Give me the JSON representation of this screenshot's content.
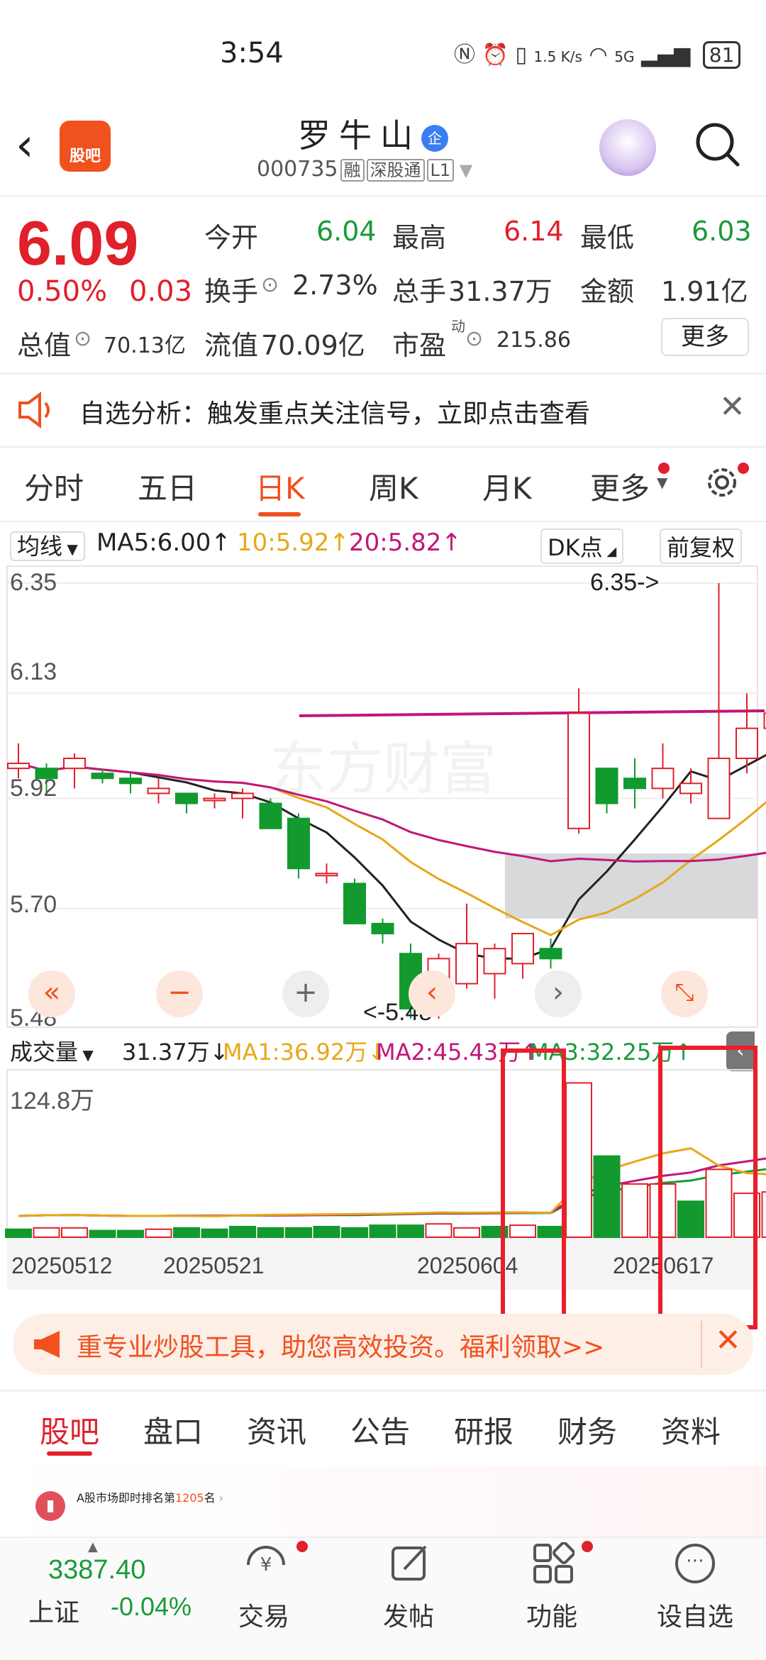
{
  "status": {
    "time": "3:54",
    "net": "1.5 K/s",
    "signal": "5G",
    "battery": "81"
  },
  "header": {
    "back": "‹",
    "logo": "股吧",
    "title": "罗牛山",
    "badge": "企",
    "code": "000735",
    "tags": [
      "融",
      "深股通",
      "L1"
    ]
  },
  "quote": {
    "price": "6.09",
    "pct": "0.50%",
    "change": "0.03",
    "open_label": "今开",
    "open": "6.04",
    "high_label": "最高",
    "high": "6.14",
    "low_label": "最低",
    "low": "6.03",
    "turnover_label": "换手",
    "turnover": "2.73%",
    "volume_label": "总手",
    "volume": "31.37万",
    "amount_label": "金额",
    "amount": "1.91亿",
    "mcap_label": "总值",
    "mcap": "70.13亿",
    "float_label": "流值",
    "float": "70.09亿",
    "pe_label": "市盈",
    "pe_sup": "动",
    "pe": "215.86",
    "more": "更多"
  },
  "alert": {
    "text": "自选分析：触发重点关注信号，立即点击查看"
  },
  "ktabs": [
    "分时",
    "五日",
    "日K",
    "周K",
    "月K",
    "更多"
  ],
  "ma": {
    "label": "均线",
    "ma5": "MA5:6.00↑",
    "ma10": "10:5.92↑",
    "ma20": "20:5.82↑",
    "dk": "DK点",
    "adjust": "前复权"
  },
  "price_axis": [
    "6.35",
    "6.13",
    "5.92",
    "5.70",
    "5.48"
  ],
  "annotations": {
    "high_mark": "6.35->",
    "low_mark": "<-5.48"
  },
  "vol": {
    "label": "成交量",
    "value": "31.37万↓",
    "ma1": "MA1:36.92万↓",
    "ma2": "MA2:45.43万↑",
    "ma3": "MA3:32.25万↑",
    "max": "124.8万"
  },
  "dates": [
    "20250512",
    "20250521",
    "20250604",
    "20250617"
  ],
  "ad": {
    "text": "重专业炒股工具，助您高效投资。福利领取>>"
  },
  "btabs": [
    "股吧",
    "盘口",
    "资讯",
    "公告",
    "研报",
    "财务",
    "资料"
  ],
  "rank": {
    "prefix": "A股市场即时排名第",
    "num": "1205",
    "suffix": "名"
  },
  "bnav": {
    "index": "3387.40",
    "index_name": "上证",
    "index_chg": "-0.04%",
    "trade": "交易",
    "post": "发帖",
    "func": "功能",
    "fav": "设自选"
  },
  "chart_data": {
    "type": "candlestick",
    "ohlc": [
      [
        5.98,
        6.03,
        5.96,
        5.99
      ],
      [
        5.98,
        5.99,
        5.93,
        5.96
      ],
      [
        5.98,
        6.01,
        5.94,
        6.0
      ],
      [
        5.97,
        5.98,
        5.95,
        5.96
      ],
      [
        5.96,
        5.97,
        5.93,
        5.95
      ],
      [
        5.93,
        5.96,
        5.91,
        5.94
      ],
      [
        5.93,
        5.93,
        5.89,
        5.91
      ],
      [
        5.92,
        5.93,
        5.9,
        5.92
      ],
      [
        5.92,
        5.94,
        5.88,
        5.93
      ],
      [
        5.91,
        5.92,
        5.86,
        5.86
      ],
      [
        5.88,
        5.89,
        5.76,
        5.78
      ],
      [
        5.77,
        5.79,
        5.75,
        5.77
      ],
      [
        5.75,
        5.76,
        5.67,
        5.67
      ],
      [
        5.67,
        5.68,
        5.63,
        5.65
      ],
      [
        5.61,
        5.63,
        5.48,
        5.5
      ],
      [
        5.52,
        5.61,
        5.48,
        5.6
      ],
      [
        5.55,
        5.71,
        5.54,
        5.63
      ],
      [
        5.57,
        5.63,
        5.52,
        5.62
      ],
      [
        5.59,
        5.65,
        5.56,
        5.65
      ],
      [
        5.62,
        5.64,
        5.58,
        5.6
      ],
      [
        5.86,
        6.14,
        5.85,
        6.09
      ],
      [
        5.98,
        5.98,
        5.89,
        5.91
      ],
      [
        5.96,
        6.0,
        5.9,
        5.94
      ],
      [
        5.94,
        6.03,
        5.92,
        5.98
      ],
      [
        5.93,
        5.98,
        5.91,
        5.95
      ],
      [
        5.88,
        6.35,
        5.88,
        6.0
      ],
      [
        6.0,
        6.13,
        5.97,
        6.06
      ],
      [
        6.06,
        6.13,
        6.03,
        6.09
      ]
    ],
    "volume": [
      6,
      7,
      7,
      5,
      5,
      6,
      7,
      6,
      8,
      7,
      7,
      8,
      7,
      9,
      9,
      10,
      7,
      8,
      9,
      8,
      116,
      61,
      40,
      40,
      27,
      51,
      33,
      34
    ],
    "volume_up": [
      true,
      false,
      false,
      true,
      true,
      false,
      true,
      true,
      true,
      true,
      true,
      true,
      true,
      true,
      true,
      false,
      false,
      true,
      false,
      true,
      false,
      true,
      false,
      false,
      true,
      false,
      false,
      false
    ],
    "ylim": [
      5.48,
      6.35
    ],
    "vol_max": 124.8
  }
}
